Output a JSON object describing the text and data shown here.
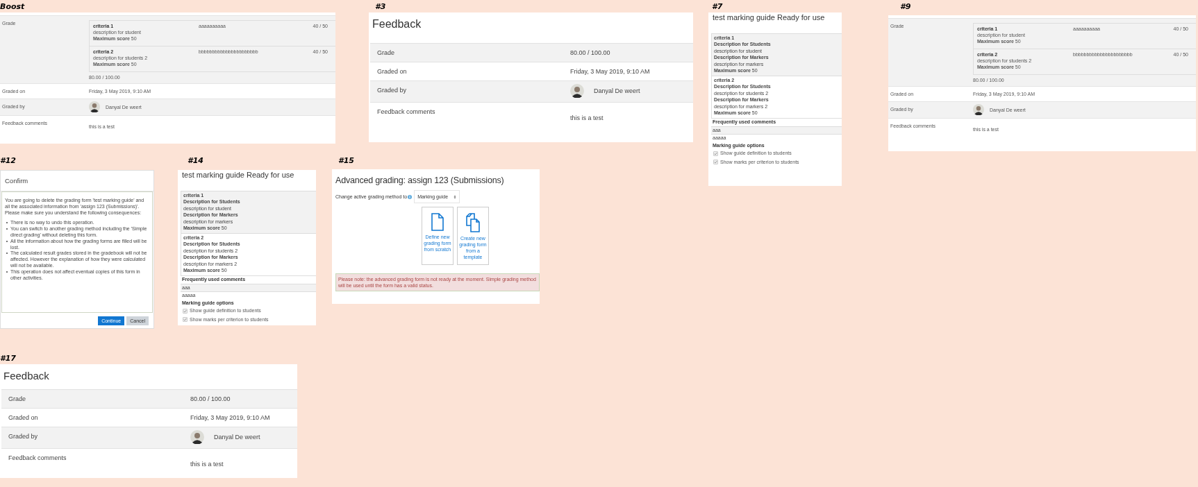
{
  "panels": [
    {
      "kind": "grade_detail",
      "label": "Boost",
      "grade_label": "Grade",
      "criteria": [
        {
          "name": "criteria 1",
          "description": "description for student",
          "max_score": "**Maximum score** 50",
          "remark": "aaaaaaaaaa",
          "score": "40 / 50"
        },
        {
          "name": "criteria 2",
          "description": "description for students 2",
          "max_score": "**Maximum score** 50",
          "remark": "bbbbbbbbbbbbbbbbbbbbbb",
          "score": "40 / 50"
        }
      ],
      "total": "80.00 / 100.00",
      "rows": [
        {
          "kind": "text",
          "label": "Graded on",
          "value": "Friday, 3 May 2019, 9:10 AM"
        },
        {
          "kind": "user",
          "label": "Graded by",
          "value": "Danyal De weert"
        },
        {
          "kind": "comment",
          "label": "Feedback comments",
          "value": "this is a test"
        }
      ]
    },
    {
      "kind": "feedback",
      "label": "#3",
      "title": "Feedback",
      "rows": [
        {
          "kind": "text",
          "label": "Grade",
          "value": "80.00 / 100.00"
        },
        {
          "kind": "text",
          "label": "Graded on",
          "value": "Friday, 3 May 2019, 9:10 AM"
        },
        {
          "kind": "user",
          "label": "Graded by",
          "value": "Danyal De weert"
        },
        {
          "kind": "comment",
          "label": "Feedback comments",
          "value": "this is a test"
        }
      ]
    },
    {
      "kind": "marking_guide",
      "label": "#7",
      "title": "test marking guide Ready for use",
      "criteria": [
        {
          "name": "criteria 1",
          "students_heading": "Description for Students",
          "students_text": "description for student",
          "markers_heading": "Description for Markers",
          "markers_text": "description for markers",
          "max_score": "**Maximum score** 50"
        },
        {
          "name": "criteria 2",
          "students_heading": "Description for Students",
          "students_text": "description for students 2",
          "markers_heading": "Description for Markers",
          "markers_text": "description for markers 2",
          "max_score": "**Maximum score** 50"
        }
      ],
      "comments_heading": "Frequently used comments",
      "comments": [
        "aaa",
        "aaaaa"
      ],
      "options_heading": "Marking guide options",
      "options": [
        {
          "label": "Show guide definition to students",
          "checked": true
        },
        {
          "label": "Show marks per criterion to students",
          "checked": true
        }
      ]
    },
    {
      "kind": "grade_detail",
      "label": "#9",
      "grade_label": "Grade",
      "criteria": [
        {
          "name": "criteria 1",
          "description": "description for student",
          "max_score": "**Maximum score** 50",
          "remark": "aaaaaaaaaa",
          "score": "40 / 50"
        },
        {
          "name": "criteria 2",
          "description": "description for students 2",
          "max_score": "**Maximum score** 50",
          "remark": "bbbbbbbbbbbbbbbbbbbbbb",
          "score": "40 / 50"
        }
      ],
      "total": "80.00 / 100.00",
      "rows": [
        {
          "kind": "text",
          "label": "Graded on",
          "value": "Friday, 3 May 2019, 9:10 AM"
        },
        {
          "kind": "user",
          "label": "Graded by",
          "value": "Danyal De weert"
        },
        {
          "kind": "comment",
          "label": "Feedback comments",
          "value": "this is a test"
        }
      ]
    },
    {
      "kind": "confirm",
      "label": "#12",
      "title": "Confirm",
      "message": "You are going to delete the grading form 'test marking guide' and all the associated information from 'assign 123 (Submissions)'. Please make sure you understand the following consequences:",
      "consequences": [
        "There is no way to undo this operation.",
        "You can switch to another grading method including the 'Simple direct grading' without deleting this form.",
        "All the information about how the grading forms are filled will be lost.",
        "The calculated result grades stored in the gradebook will not be affected. However the explanation of how they were calculated will not be available.",
        "This operation does not affect eventual copies of this form in other activities."
      ],
      "buttons": [
        {
          "kind": "primary",
          "label": "Continue"
        },
        {
          "kind": "secondary",
          "label": "Cancel"
        }
      ]
    },
    {
      "kind": "marking_guide",
      "label": "#14",
      "title": "test marking guide Ready for use",
      "criteria": [
        {
          "name": "criteria 1",
          "students_heading": "Description for Students",
          "students_text": "description for student",
          "markers_heading": "Description for Markers",
          "markers_text": "description for markers",
          "max_score": "**Maximum score** 50"
        },
        {
          "name": "criteria 2",
          "students_heading": "Description for Students",
          "students_text": "description for students 2",
          "markers_heading": "Description for Markers",
          "markers_text": "description for markers 2",
          "max_score": "**Maximum score** 50"
        }
      ],
      "comments_heading": "Frequently used comments",
      "comments": [
        "aaa",
        "aaaaa"
      ],
      "options_heading": "Marking guide options",
      "options": [
        {
          "label": "Show guide definition to students",
          "checked": true
        },
        {
          "label": "Show marks per criterion to students",
          "checked": true
        }
      ]
    },
    {
      "kind": "advanced_grading",
      "label": "#15",
      "title": "Advanced grading: assign 123 (Submissions)",
      "method_label": "Change active grading method to",
      "method_value": "Marking guide",
      "actions": [
        {
          "kind": "scratch",
          "label": "Define new grading form from scratch"
        },
        {
          "kind": "template",
          "label": "Create new grading form from a template"
        }
      ],
      "notice": "Please note: the advanced grading form is not ready at the moment. Simple grading method will be used until the form has a valid status."
    },
    {
      "kind": "feedback",
      "label": "#17",
      "title": "Feedback",
      "rows": [
        {
          "kind": "text",
          "label": "Grade",
          "value": "80.00 / 100.00"
        },
        {
          "kind": "text",
          "label": "Graded on",
          "value": "Friday, 3 May 2019, 9:10 AM"
        },
        {
          "kind": "user",
          "label": "Graded by",
          "value": "Danyal De weert"
        },
        {
          "kind": "comment",
          "label": "Feedback comments",
          "value": "this is a test"
        }
      ]
    }
  ]
}
